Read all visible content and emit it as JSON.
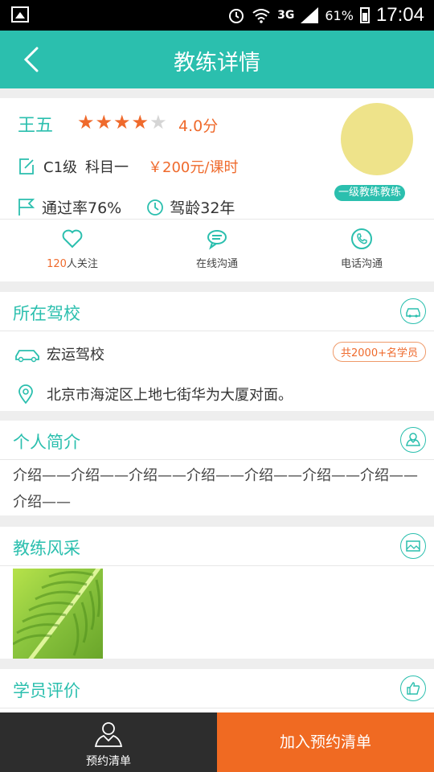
{
  "statusbar": {
    "network": "3G",
    "battery": "61%",
    "time": "17:04"
  },
  "titlebar": {
    "title": "教练详情"
  },
  "profile": {
    "name": "王五",
    "rating_stars": 4,
    "rating_max": 5,
    "score": "4.0分",
    "license": "C1级",
    "subject": "科目一",
    "price": "￥200元/课时",
    "pass_rate": "通过率76%",
    "driving_years": "驾龄32年",
    "level_badge": "一级教练教练"
  },
  "actions": {
    "follow_count": "120",
    "follow_label": "人关注",
    "chat_label": "在线沟通",
    "phone_label": "电话沟通"
  },
  "school": {
    "heading": "所在驾校",
    "name": "宏运驾校",
    "students_badge": "共2000+名学员",
    "address": "北京市海淀区上地七街华为大厦对面。"
  },
  "intro": {
    "heading": "个人简介",
    "text": "介绍——介绍——介绍——介绍——介绍——介绍——介绍——介绍——"
  },
  "gallery": {
    "heading": "教练风采"
  },
  "review": {
    "heading": "学员评价"
  },
  "bottombar": {
    "list_label": "预约清单",
    "add_label": "加入预约清单"
  },
  "colors": {
    "accent": "#2bbfae",
    "orange": "#ef6a2c",
    "cta": "#f06a22"
  }
}
